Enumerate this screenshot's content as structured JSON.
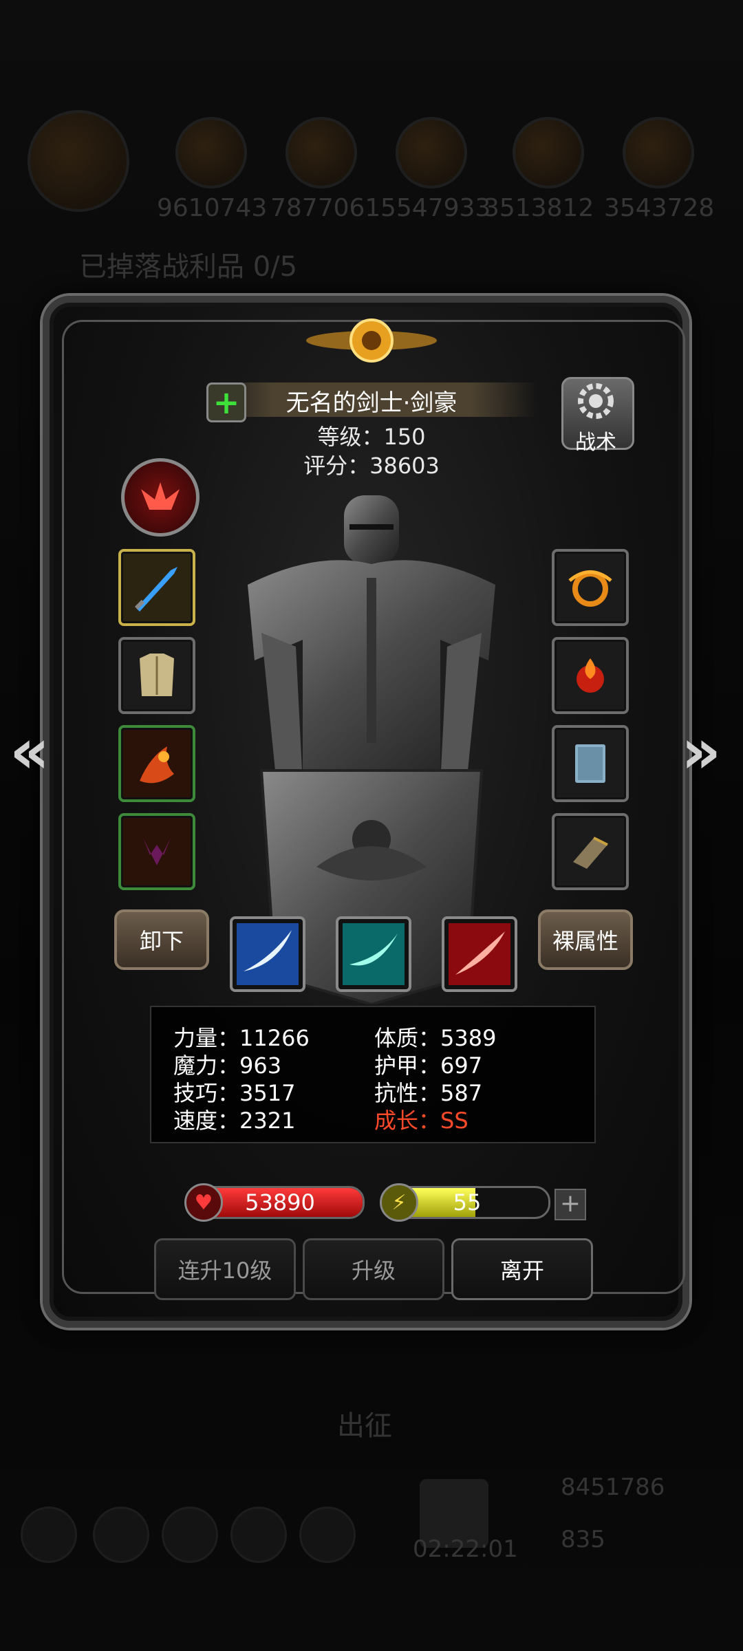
{
  "background": {
    "resources": [
      "9610743",
      "7877061",
      "5547933",
      "3513812",
      "3543728"
    ],
    "loot_text": "已掉落战利品 0/5",
    "expedition_label": "出征",
    "timer": "02:22:01",
    "gold": "8451786",
    "gems": "835"
  },
  "hero": {
    "name": "无名的剑士·剑豪",
    "level_text": "等级：150",
    "score_text": "评分：38603"
  },
  "tactics_label": "战术",
  "buttons": {
    "unequip": "卸下",
    "naked_attr": "裸属性",
    "level_up_10": "连升10级",
    "level_up": "升级",
    "leave": "离开"
  },
  "attributes": [
    {
      "label": "力量：11266"
    },
    {
      "label": "体质：5389"
    },
    {
      "label": "魔力：963"
    },
    {
      "label": "护甲：697"
    },
    {
      "label": "技巧：3517"
    },
    {
      "label": "抗性：587"
    },
    {
      "label": "速度：2321"
    },
    {
      "label": "成长：SS"
    }
  ],
  "hp": {
    "value": "53890",
    "fill": 1.0
  },
  "energy": {
    "value": "55",
    "fill": 0.55
  },
  "colors": {
    "hp": "#d8161a",
    "energy": "#d8d81a",
    "growth": "#ff4a2a"
  },
  "icons": {
    "left_slots": [
      "sword-icon",
      "armor-icon",
      "flame-weapon-icon",
      "dark-crest-icon"
    ],
    "right_slots": [
      "fire-ring-icon",
      "fire-orb-icon",
      "book-icon",
      "bracer-icon"
    ],
    "skills": [
      "slash-blue-icon",
      "slash-cyan-icon",
      "slash-red-icon"
    ]
  }
}
